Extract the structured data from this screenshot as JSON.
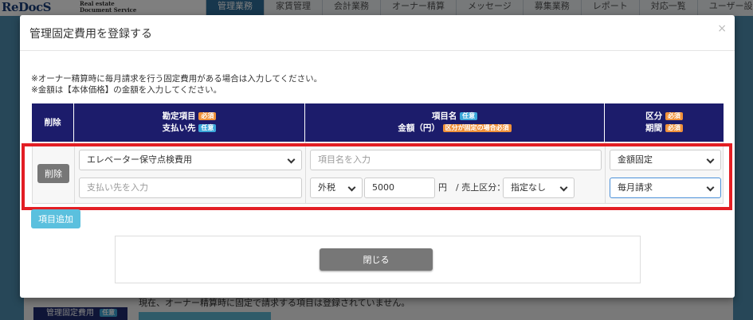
{
  "app": {
    "logo": "ReDocS",
    "logo_sub_1": "Real estate",
    "logo_sub_2": "Document Service",
    "nav": [
      "管理業務",
      "家賃管理",
      "会計業務",
      "オーナー精算",
      "メッセージ",
      "募集業務",
      "レポート",
      "対応一覧",
      "ユーザー設定"
    ],
    "bg_section_label": "管理固定費用",
    "bg_section_badge": "任意",
    "bg_text": "現在、オーナー精算時に固定で請求する項目は登録されていません。"
  },
  "modal": {
    "title": "管理固定費用を登録する",
    "close": "×",
    "note1": "※オーナー精算時に毎月請求を行う固定費用がある場合は入力してください。",
    "note2": "※金額は【本体価格】の金額を入力してください。",
    "header": {
      "col1": "削除",
      "col2_line1": "勘定項目",
      "col2_line1_badge": "必須",
      "col2_line2": "支払い先",
      "col2_line2_badge": "任意",
      "col3_line1": "項目名",
      "col3_line1_badge": "任意",
      "col3_line2": "金額（円）",
      "col3_line2_badge": "区分が固定の場合必須",
      "col4_line1": "区分",
      "col4_line1_badge": "必須",
      "col4_line2": "期間",
      "col4_line2_badge": "必須"
    },
    "row": {
      "delete_label": "削除",
      "account_item": "エレベーター保守点検費用",
      "payee_placeholder": "支払い先を入力",
      "item_name_placeholder": "項目名を入力",
      "tax_type": "外税",
      "amount": "5000",
      "yen": "円",
      "sales_class_label": "/ 売上区分：",
      "sales_class": "指定なし",
      "category": "金額固定",
      "period": "毎月請求"
    },
    "add_label": "項目追加",
    "close_label": "閉じる"
  },
  "colors": {
    "header_bg": "#1c1c6b",
    "required_badge": "#f0913a",
    "optional_badge": "#3aa6d9",
    "highlight": "#e31e24"
  }
}
